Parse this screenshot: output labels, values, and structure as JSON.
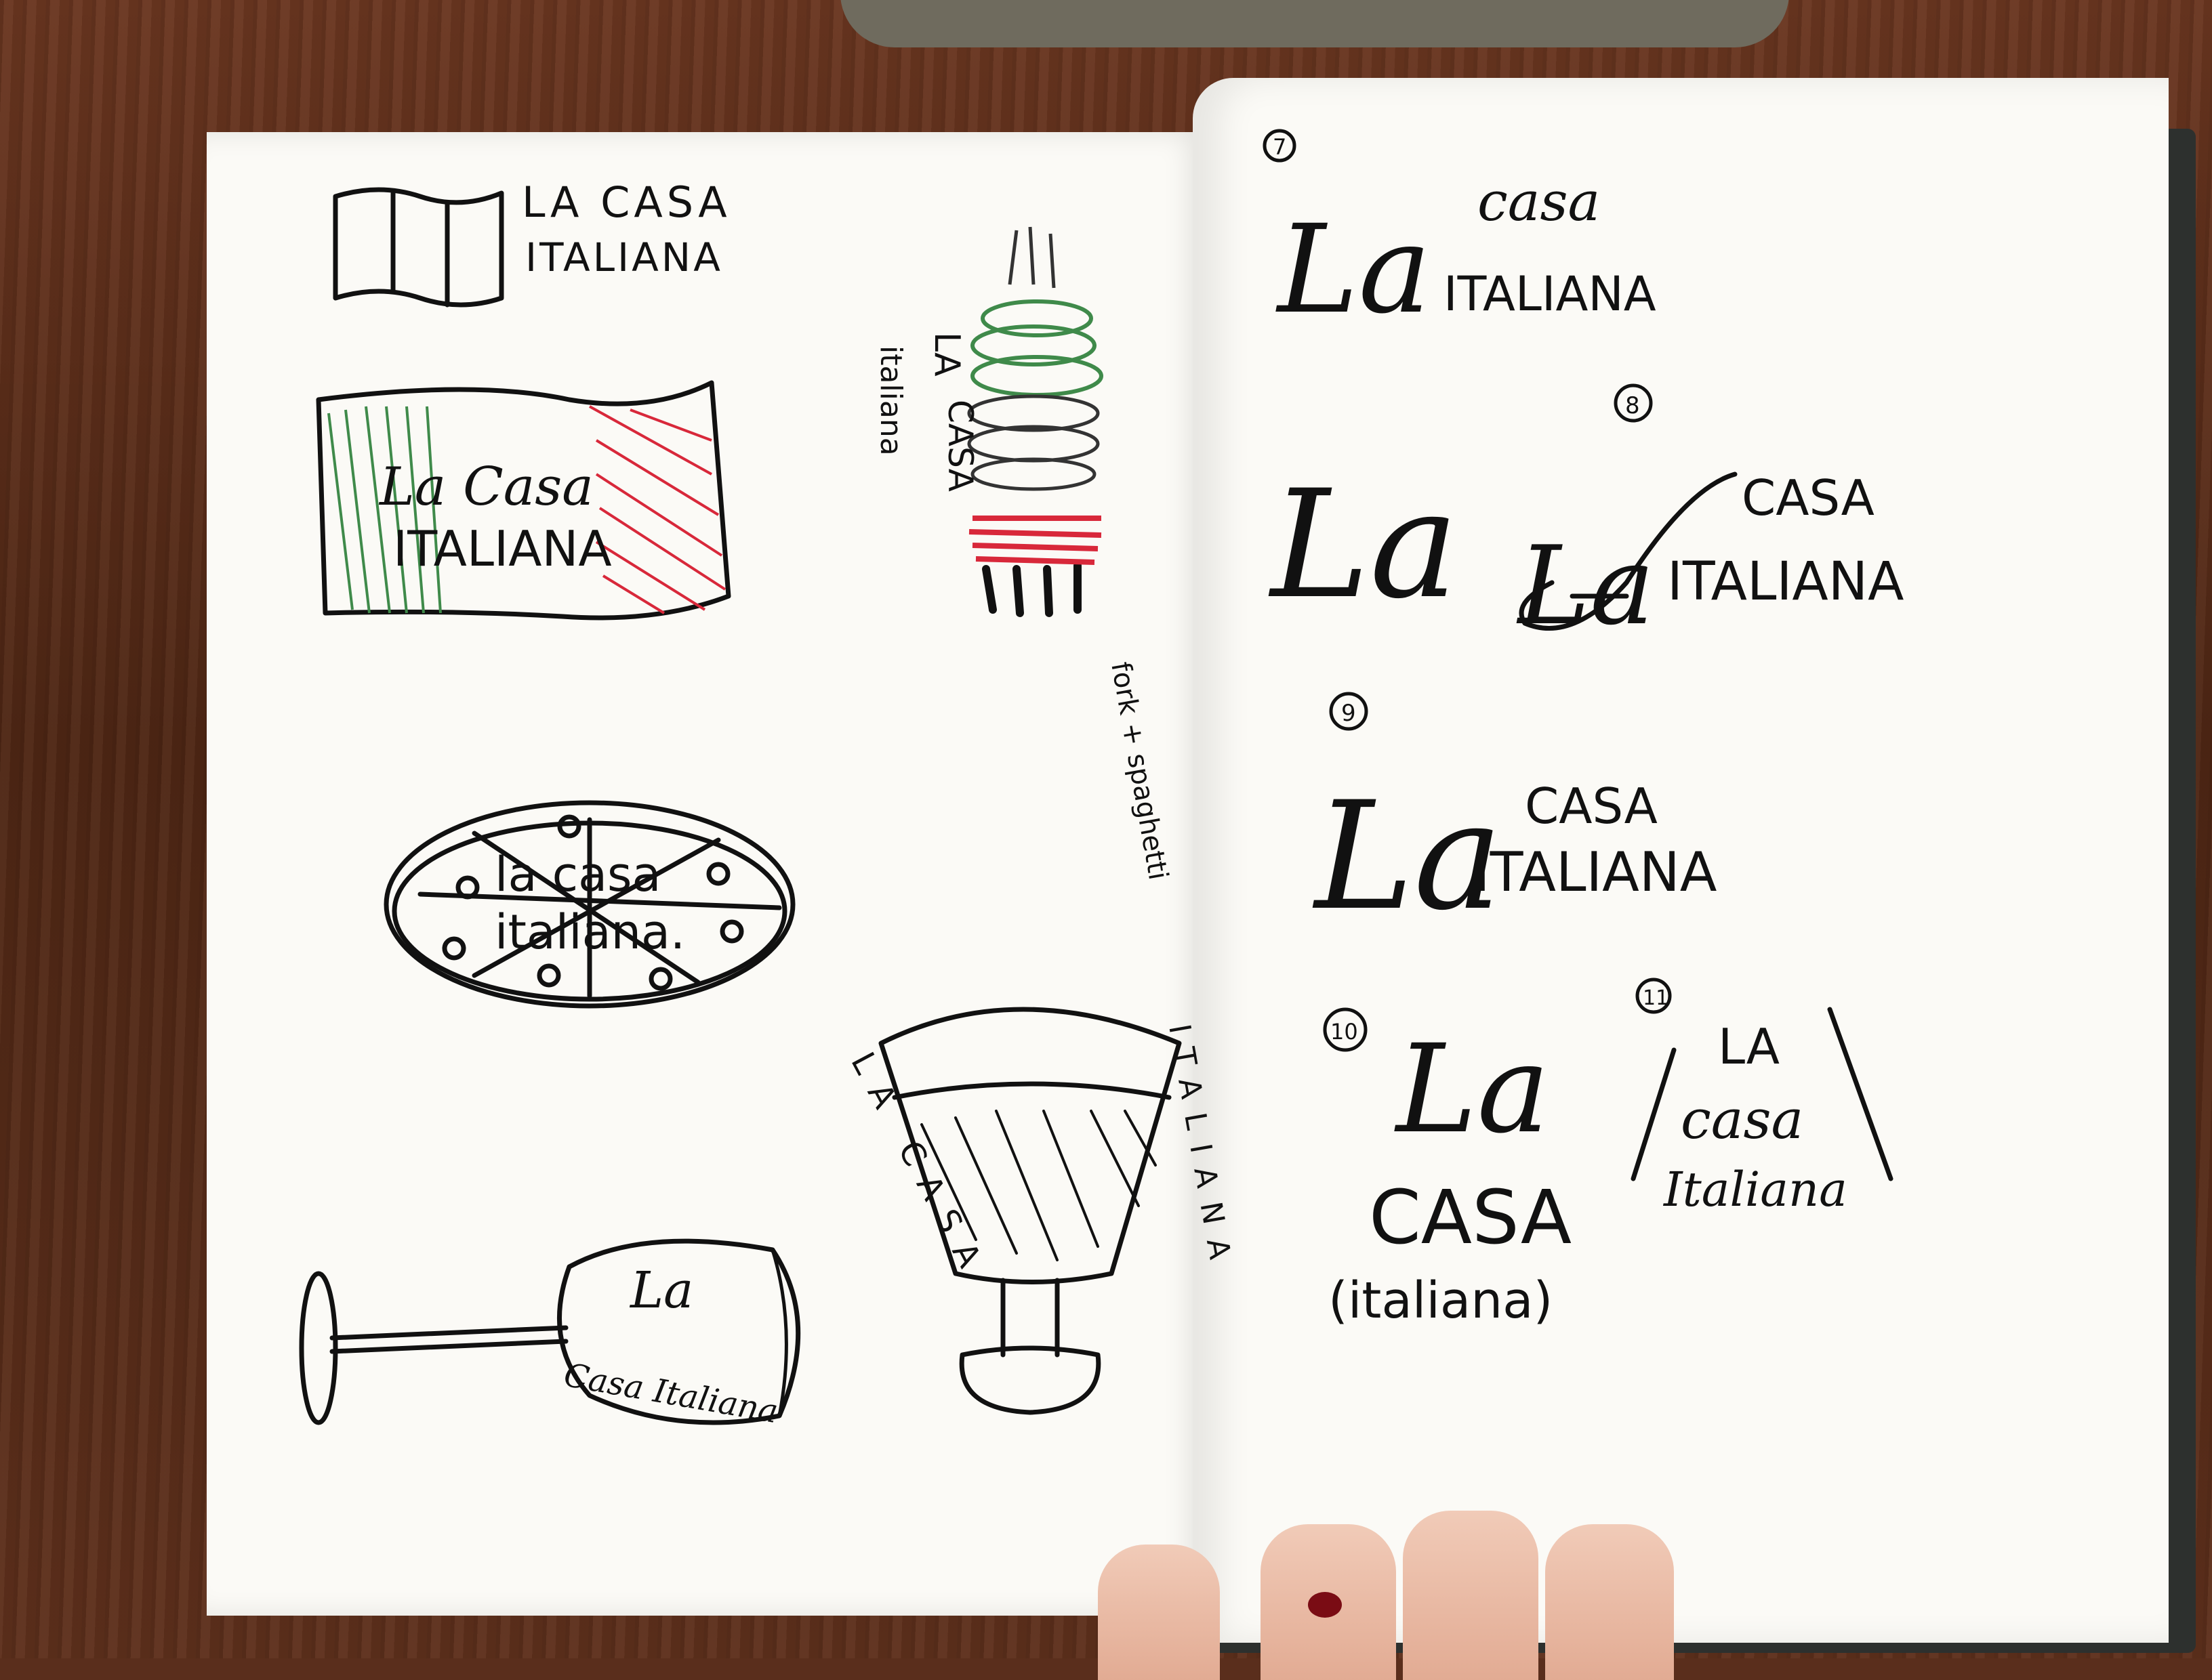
{
  "left_page": {
    "sketch1": {
      "line1": "LA CASA",
      "line2": "ITALIANA"
    },
    "sketch2_flag": {
      "line1": "La Casa",
      "line2": "ITALIANA"
    },
    "sketch3_fork": {
      "letters_la": "LA",
      "letters_casa": "CASA",
      "italiana": "italiana",
      "note": "fork + spaghetti"
    },
    "sketch4_pizza": {
      "line1": "la casa",
      "line2": "italiana."
    },
    "sketch5_glass": {
      "left_text": "LA CASA",
      "right_text": "ITALIANA"
    },
    "sketch6_wineglass": {
      "line1": "La",
      "line2": "Casa Italiana"
    }
  },
  "right_page": {
    "concept7": {
      "number": "7",
      "la": "La",
      "casa": "casa",
      "italiana": "ITALIANA"
    },
    "concept8a": {
      "number": "8",
      "la": "La"
    },
    "concept8b": {
      "casa": "CASA",
      "la": "La",
      "italiana": "ITALIANA"
    },
    "concept9": {
      "number": "9",
      "la": "La",
      "casa": "CASA",
      "italiana": "ITALIANA"
    },
    "concept10": {
      "number": "10",
      "la": "La",
      "casa": "CASA",
      "italiana": "(italiana)"
    },
    "concept11": {
      "number": "11",
      "la": "LA",
      "casa": "casa",
      "italiana": "Italiana"
    }
  },
  "colors": {
    "ink": "#111111",
    "green": "#3f8a4a",
    "red": "#d8283a",
    "paper": "#fbfaf6",
    "nail": "#7a0c14"
  }
}
